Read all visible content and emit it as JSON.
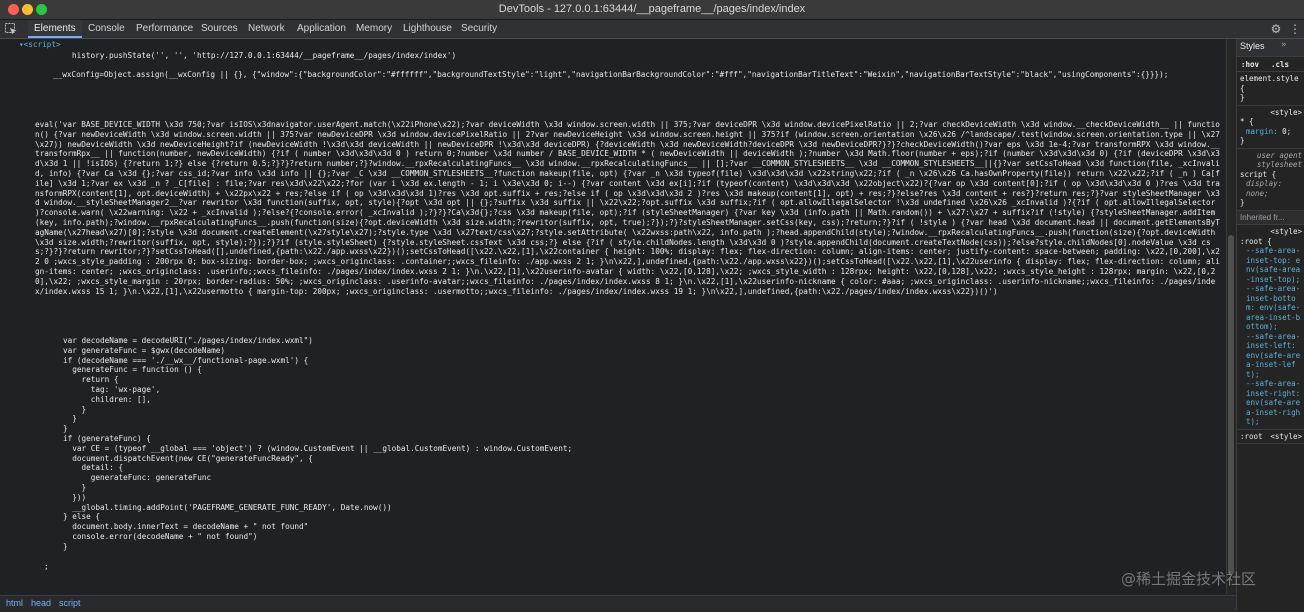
{
  "window": {
    "title": "DevTools - 127.0.0.1:63444/__pageframe__/pages/index/index"
  },
  "tabs": [
    "Elements",
    "Console",
    "Performance",
    "Sources",
    "Network",
    "Application",
    "Memory",
    "Lighthouse",
    "Security"
  ],
  "icons": {
    "inspect": "inspect-element-icon",
    "settings": "gear-icon",
    "more": "more-options-icon"
  },
  "code": {
    "script_tag": "▾<script>",
    "pushstate": "history.pushState('', '', 'http://127.0.0.1:63444/__pageframe__/pages/index/index')",
    "wxconfig": "__wxConfig=Object.assign(__wxConfig || {}, {\"window\":{\"backgroundColor\":\"#ffffff\",\"backgroundTextStyle\":\"light\",\"navigationBarBackgroundColor\":\"#fff\",\"navigationBarTitleText\":\"Weixin\",\"navigationBarTextStyle\":\"black\",\"usingComponents\":{}}});",
    "eval_block": "eval('var BASE_DEVICE_WIDTH \\x3d 750;?var isIOS\\x3dnavigator.userAgent.match(\\x22iPhone\\x22);?var deviceWidth \\x3d window.screen.width || 375;?var deviceDPR \\x3d window.devicePixelRatio || 2;?var checkDeviceWidth \\x3d window.__checkDeviceWidth__ || function() {?var newDeviceWidth \\x3d window.screen.width || 375?var newDeviceDPR \\x3d window.devicePixelRatio || 2?var newDeviceHeight \\x3d window.screen.height || 375?if (window.screen.orientation \\x26\\x26 /^landscape/.test(window.screen.orientation.type || \\x27\\x27)) newDeviceWidth \\x3d newDeviceHeight?if (newDeviceWidth !\\x3d\\x3d deviceWidth || newDeviceDPR !\\x3d\\x3d deviceDPR) {?deviceWidth \\x3d newDeviceWidth?deviceDPR \\x3d newDeviceDPR?}?}?checkDeviceWidth()?var eps \\x3d 1e-4;?var transformRPX \\x3d window.__transformRpx__ || function(number, newDeviceWidth) {?if ( number \\x3d\\x3d\\x3d 0 ) return 0;?number \\x3d number / BASE_DEVICE_WIDTH * ( newDeviceWidth || deviceWidth );?number \\x3d Math.floor(number + eps);?if (number \\x3d\\x3d\\x3d 0) {?if (deviceDPR \\x3d\\x3d\\x3d 1 || !isIOS) {?return 1;?} else {?return 0.5;?}?}?return number;?}?window.__rpxRecalculatingFuncs__ \\x3d window.__rpxRecalculatingFuncs__ || [];?var __COMMON_STYLESHEETS__ \\x3d __COMMON_STYLESHEETS__||{}?var setCssToHead \\x3d function(file, _xcInvalid, info) {?var Ca \\x3d {};?var css_id;?var info \\x3d info || {};?var _C \\x3d __COMMON_STYLESHEETS__?function makeup(file, opt) {?var _n \\x3d typeof(file) \\x3d\\x3d\\x3d \\x22string\\x22;?if ( _n \\x26\\x26 Ca.hasOwnProperty(file)) return \\x22\\x22;?if ( _n ) Ca[file] \\x3d 1;?var ex \\x3d _n ? _C[file] : file;?var res\\x3d\\x22\\x22;?for (var i \\x3d ex.length - 1; i \\x3e\\x3d 0; i--) {?var content \\x3d ex[i];?if (typeof(content) \\x3d\\x3d\\x3d \\x22object\\x22)?{?var op \\x3d content[0];?if ( op \\x3d\\x3d\\x3d 0 )?res \\x3d transformRPX(content[1], opt.deviceWidth) + \\x22px\\x22 + res;?else if ( op \\x3d\\x3d\\x3d 1)?res \\x3d opt.suffix + res;?else if ( op \\x3d\\x3d\\x3d 2 )?res \\x3d makeup(content[1], opt) + res;?}?else?res \\x3d content + res?}?return res;?}?var styleSheetManager \\x3d window.__styleSheetManager2__?var rewritor \\x3d function(suffix, opt, style){?opt \\x3d opt || {};?suffix \\x3d suffix || \\x22\\x22;?opt.suffix \\x3d suffix;?if ( opt.allowIllegalSelector !\\x3d undefined \\x26\\x26 _xcInvalid )?{?if ( opt.allowIllegalSelector )?console.warn( \\x22warning: \\x22 + _xcInvalid );?else?{?console.error( _xcInvalid );?}?}?Ca\\x3d{};?css \\x3d makeup(file, opt);?if (styleSheetManager) {?var key \\x3d (info.path || Math.random()) + \\x27:\\x27 + suffix?if (!style) {?styleSheetManager.addItem(key, info.path);?window.__rpxRecalculatingFuncs__.push(function(size){?opt.deviceWidth \\x3d size.width;?rewritor(suffix, opt, true);?});?}?styleSheetManager.setCss(key, css);?return;?}?if ( !style ) {?var head \\x3d document.head || document.getElementsByTagName(\\x27head\\x27)[0];?style \\x3d document.createElement(\\x27style\\x27);?style.type \\x3d \\x27text/css\\x27;?style.setAttribute( \\x22wxss:path\\x22, info.path );?head.appendChild(style);?window.__rpxRecalculatingFuncs__.push(function(size){?opt.deviceWidth \\x3d size.width;?rewritor(suffix, opt, style);?});?}?if (style.styleSheet) {?style.styleSheet.cssText \\x3d css;?} else {?if ( style.childNodes.length \\x3d\\x3d 0 )?style.appendChild(document.createTextNode(css));?else?style.childNodes[0].nodeValue \\x3d css;?}?}?return rewritor;?}?setCssToHead([],undefined,{path:\\x22./app.wxss\\x22})();setCssToHead([\\x22.\\x22,[1],\\x22container { height: 100%; display: flex; flex-direction: column; align-items: center; justify-content: space-between; padding: \\x22,[0,200],\\x22 0 ;wxcs_style_padding : 200rpx 0; box-sizing: border-box; ;wxcs_originclass: .container;;wxcs_fileinfo: ./app.wxss 2 1; }\\n\\x22,],undefined,{path:\\x22./app.wxss\\x22})();setCssToHead([\\x22.\\x22,[1],\\x22userinfo { display: flex; flex-direction: column; align-items: center; ;wxcs_originclass: .userinfo;;wxcs_fileinfo: ./pages/index/index.wxss 2 1; }\\n.\\x22,[1],\\x22userinfo-avatar { width: \\x22,[0,128],\\x22; ;wxcs_style_width : 128rpx; height: \\x22,[0,128],\\x22; ;wxcs_style_height : 128rpx; margin: \\x22,[0,20],\\x22; ;wxcs_style_margin : 20rpx; border-radius: 50%; ;wxcs_originclass: .userinfo-avatar;;wxcs_fileinfo: ./pages/index/index.wxss 8 1; }\\n.\\x22,[1],\\x22userinfo-nickname { color: #aaa; ;wxcs_originclass: .userinfo-nickname;;wxcs_fileinfo: ./pages/index/index.wxss 15 1; }\\n.\\x22,[1],\\x22usermotto { margin-top: 200px; ;wxcs_originclass: .usermotto;;wxcs_fileinfo: ./pages/index/index.wxss 19 1; }\\n\\x22,],undefined,{path:\\x22./pages/index/index.wxss\\x22})()')",
    "lines": [
      "var decodeName = decodeURI(\"./pages/index/index.wxml\")",
      "var generateFunc = $gwx(decodeName)",
      "if (decodeName === './__wx__/functional-page.wxml') {",
      "  generateFunc = function () {",
      "    return {",
      "      tag: 'wx-page',",
      "      children: [],",
      "    }",
      "  }",
      "}",
      "if (generateFunc) {",
      "  var CE = (typeof __global === 'object') ? (window.CustomEvent || __global.CustomEvent) : window.CustomEvent;",
      "  document.dispatchEvent(new CE(\"generateFuncReady\", {",
      "    detail: {",
      "      generateFunc: generateFunc",
      "    }",
      "  }))",
      "  __global.timing.addPoint('PAGEFRAME_GENERATE_FUNC_READY', Date.now())",
      "} else {",
      "  document.body.innerText = decodeName + \" not found\"",
      "  console.error(decodeName + \" not found\")",
      "}"
    ],
    "closing": ";"
  },
  "styles_panel": {
    "tab": "Styles",
    "chevron": "»",
    "hov": ":hov",
    "cls": ".cls",
    "element_style": "element.style {",
    "close_brace": "}",
    "rule1_selector": "* {",
    "rule1_prop": "margin:",
    "rule1_val": "0;",
    "rule1_source": "<style>",
    "ua_label": "user agent stylesheet",
    "ua_selector": "script {",
    "ua_prop": "display",
    "ua_val": ": none;",
    "inherited": "Inherited fr...",
    "root_selector": ":root {",
    "root_source": "<style>",
    "vars": [
      "--safe-area-inset-top: env(safe-area-inset-top);",
      "--safe-area-inset-bottom: env(safe-area-inset-bottom);",
      "--safe-area-inset-left: env(safe-area-inset-left);",
      "--safe-area-inset-right: env(safe-area-inset-right);"
    ],
    "root2_selector": ":root",
    "root2_source": "<style>"
  },
  "breadcrumbs": [
    "html",
    "head",
    "script"
  ],
  "watermark": "@稀土掘金技术社区"
}
